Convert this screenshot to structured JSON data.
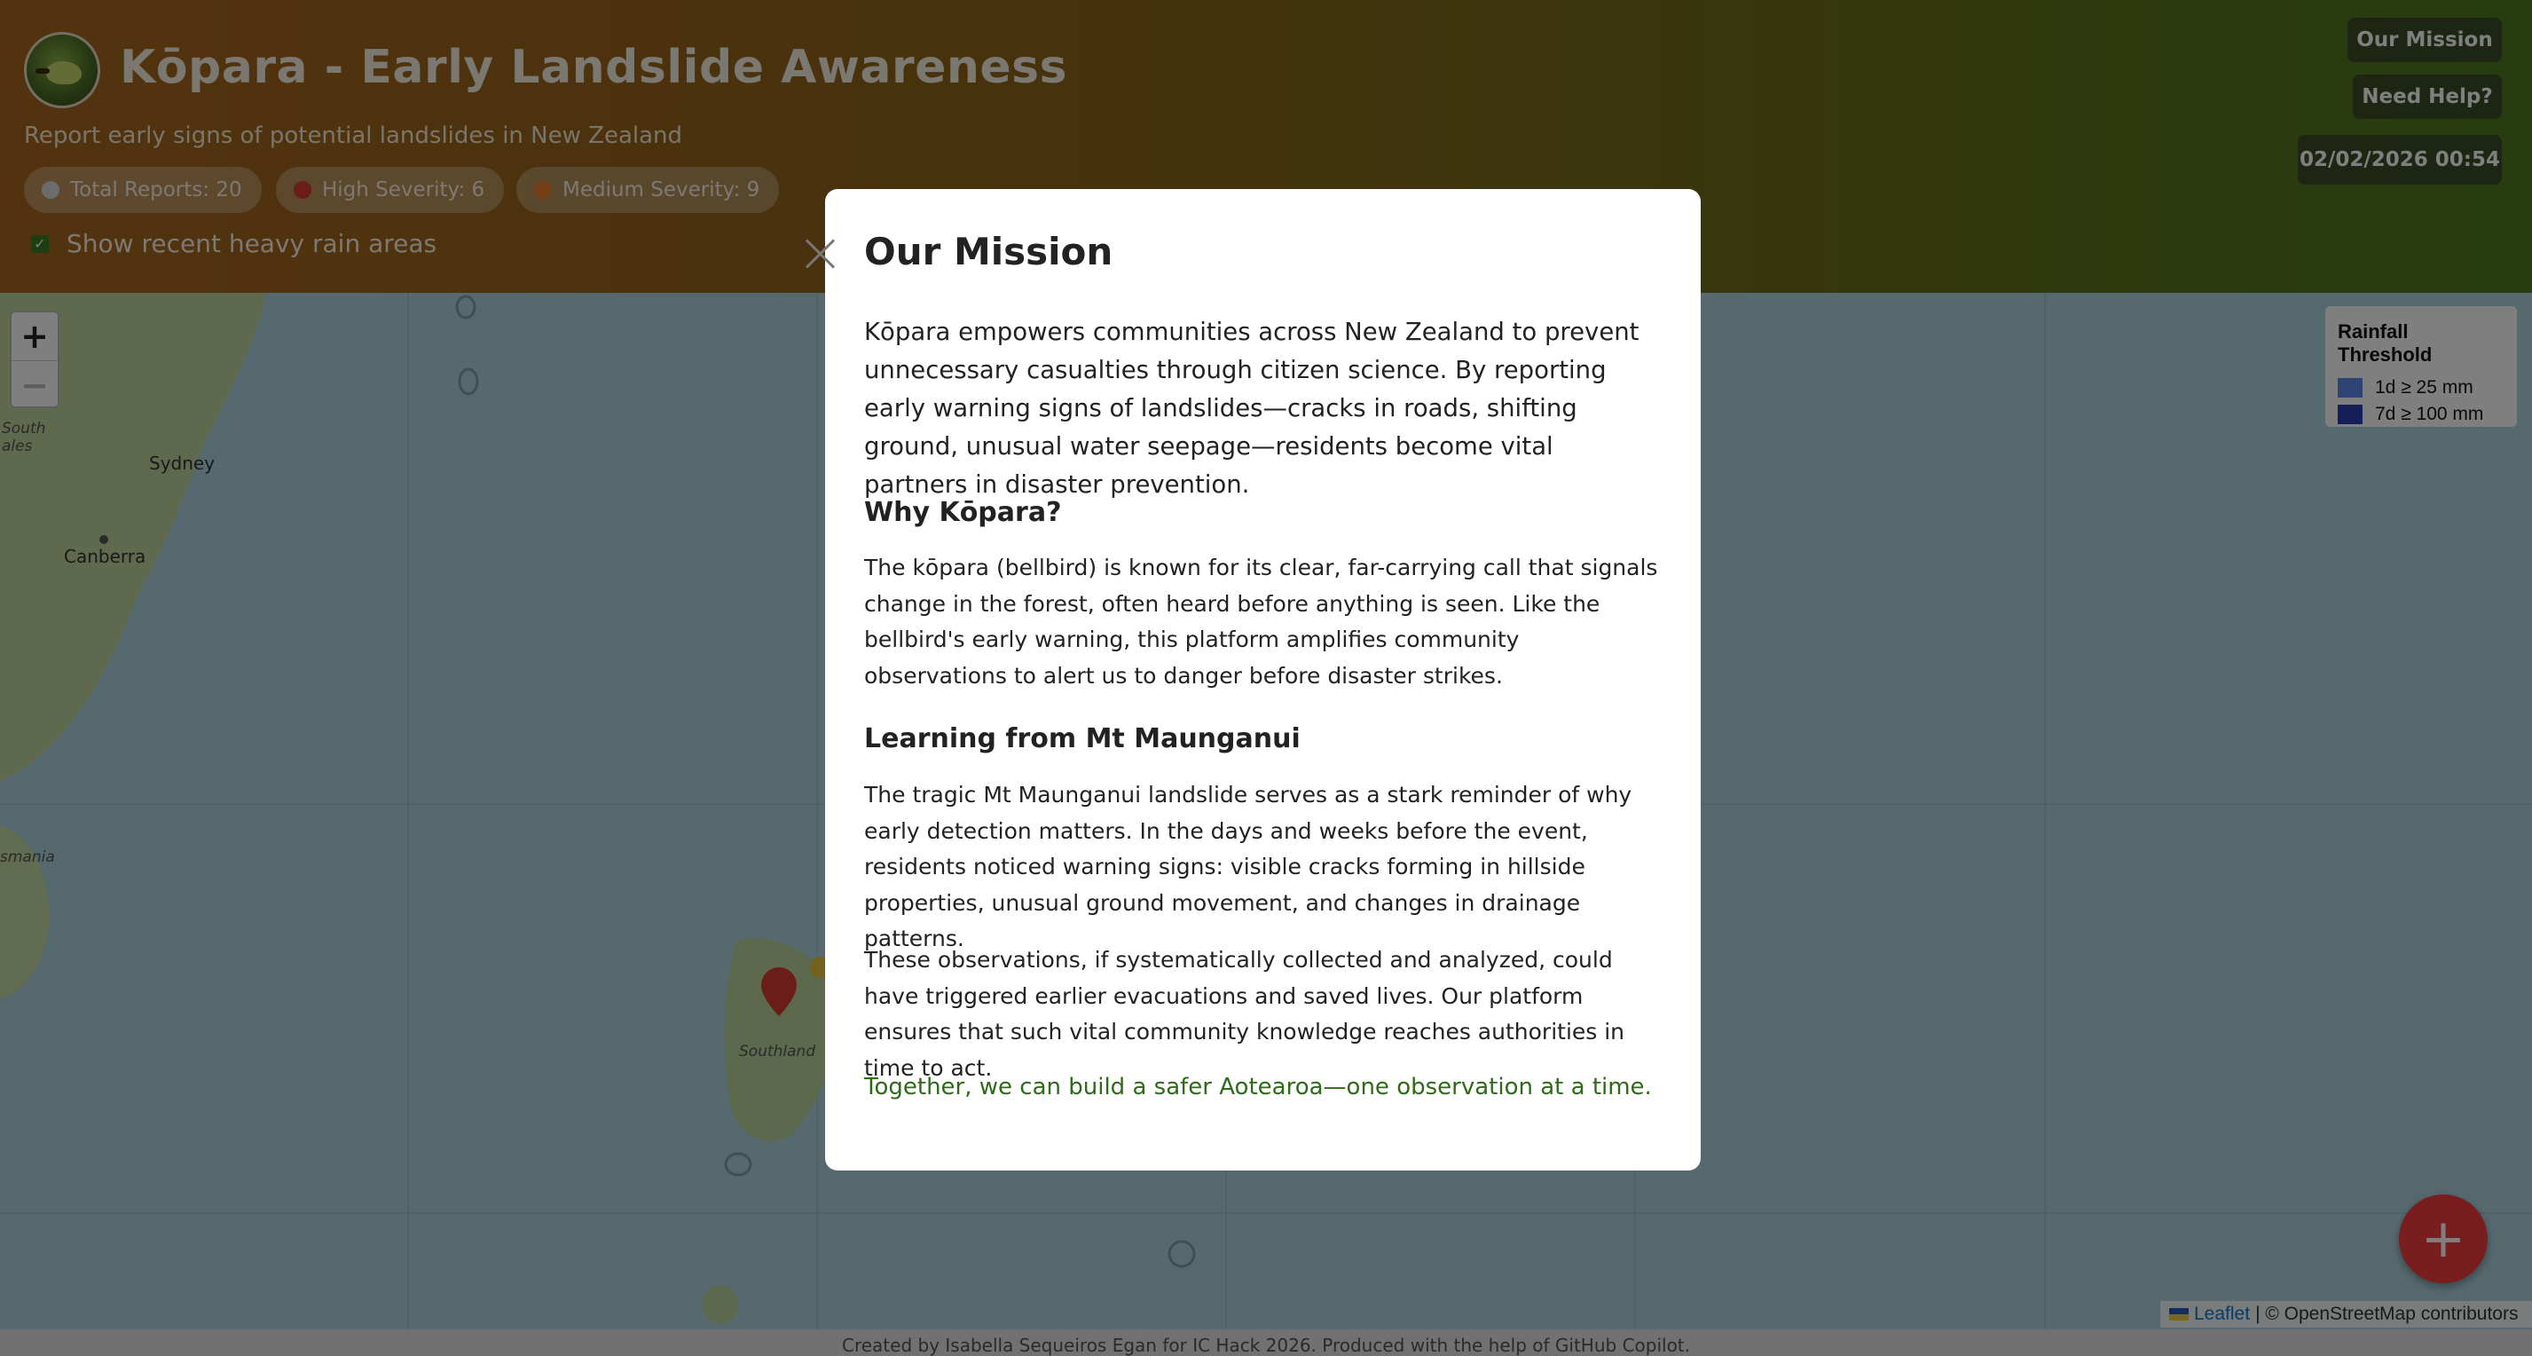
{
  "header": {
    "title": "Kōpara - Early Landslide Awareness",
    "subtitle": "Report early signs of potential landslides in New Zealand",
    "stats": [
      {
        "label": "Total Reports: 20",
        "color": "#d8d8d8"
      },
      {
        "label": "High Severity: 6",
        "color": "#d63a32"
      },
      {
        "label": "Medium Severity: 9",
        "color": "#e67a2c"
      }
    ],
    "rain_toggle": {
      "label": "Show recent heavy rain areas",
      "checked": true
    },
    "buttons": {
      "mission": "Our Mission",
      "help": "Need Help?"
    },
    "datetime": "02/02/2026 00:54"
  },
  "map": {
    "zoom_in": "+",
    "zoom_out": "−",
    "labels": {
      "south_wales": "South\nales",
      "sydney": "Sydney",
      "canberra": "Canberra",
      "tasmania": "smania",
      "southland": "Southland"
    },
    "legend": {
      "title": "Rainfall Threshold",
      "items": [
        {
          "label": "1d ≥ 25 mm",
          "color": "#5b86e8"
        },
        {
          "label": "7d ≥ 100 mm",
          "color": "#2a3fae"
        }
      ]
    },
    "attribution": {
      "leaflet": "Leaflet",
      "rest": "| © OpenStreetMap contributors"
    },
    "add_report_icon": "plus-icon"
  },
  "footer": "Created by Isabella Sequeiros Egan for IC Hack 2026. Produced with the help of GitHub Copilot.",
  "modal": {
    "title": "Our Mission",
    "lead": "Kōpara empowers communities across New Zealand to prevent unnecessary casualties through citizen science. By reporting early warning signs of landslides—cracks in roads, shifting ground, unusual water seepage—residents become vital partners in disaster prevention.",
    "why_heading": "Why Kōpara?",
    "why_text": "The kōpara (bellbird) is known for its clear, far-carrying call that signals change in the forest, often heard before anything is seen. Like the bellbird's early warning, this platform amplifies community observations to alert us to danger before disaster strikes.",
    "learning_heading": "Learning from Mt Maunganui",
    "learning_text": "The tragic Mt Maunganui landslide serves as a stark reminder of why early detection matters. In the days and weeks before the event, residents noticed warning signs: visible cracks forming in hillside properties, unusual ground movement, and changes in drainage patterns.",
    "observations_text": "These observations, if systematically collected and analyzed, could have triggered earlier evacuations and saved lives. Our platform ensures that such vital community knowledge reaches authorities in time to act.",
    "tagline": "Together, we can build a safer Aotearoa—one observation at a time."
  }
}
